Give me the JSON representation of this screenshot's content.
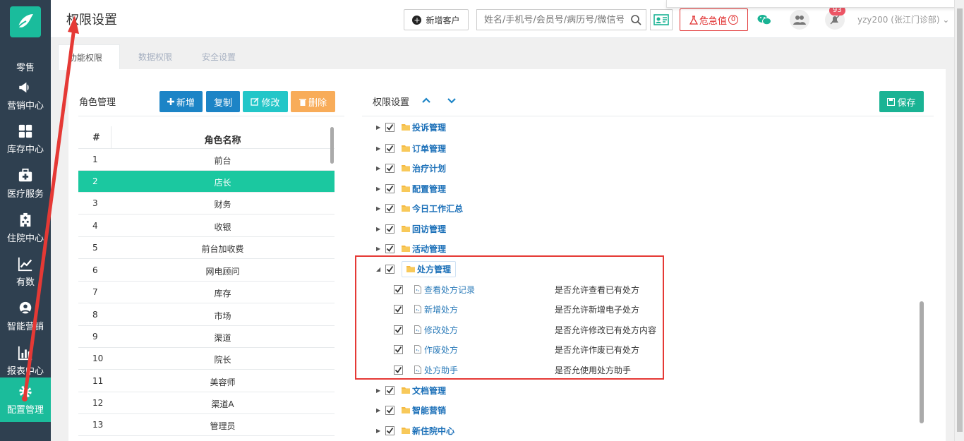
{
  "sidebar": {
    "items": [
      {
        "label": "零售",
        "icon": "retail-icon"
      },
      {
        "label": "营销中心",
        "icon": "megaphone-icon"
      },
      {
        "label": "库存中心",
        "icon": "grid-icon"
      },
      {
        "label": "医疗服务",
        "icon": "medkit-icon"
      },
      {
        "label": "住院中心",
        "icon": "hospital-icon"
      },
      {
        "label": "有数",
        "icon": "line-chart-icon"
      },
      {
        "label": "智能营销",
        "icon": "brain-icon"
      },
      {
        "label": "报表中心",
        "icon": "bar-chart-icon"
      },
      {
        "label": "配置管理",
        "icon": "gear-icon"
      }
    ],
    "active_index": 8
  },
  "header": {
    "title": "权限设置",
    "new_customer": "新增客户",
    "search_placeholder": "姓名/手机号/会员号/病历号/微信号",
    "danger_label": "危急值",
    "danger_count": "0",
    "notification_badge": "93",
    "user": "yzy200 (张江门诊部)"
  },
  "tabs": [
    "功能权限",
    "数据权限",
    "安全设置"
  ],
  "left_panel": {
    "title": "角色管理",
    "buttons": {
      "add": "新增",
      "copy": "复制",
      "edit": "修改",
      "delete": "删除"
    },
    "table": {
      "headers": [
        "#",
        "角色名称"
      ],
      "rows": [
        {
          "idx": "1",
          "name": "前台"
        },
        {
          "idx": "2",
          "name": "店长"
        },
        {
          "idx": "3",
          "name": "财务"
        },
        {
          "idx": "4",
          "name": "收银"
        },
        {
          "idx": "5",
          "name": "前台加收费"
        },
        {
          "idx": "6",
          "name": "网电顾问"
        },
        {
          "idx": "7",
          "name": "库存"
        },
        {
          "idx": "8",
          "name": "市场"
        },
        {
          "idx": "9",
          "name": "渠道"
        },
        {
          "idx": "10",
          "name": "院长"
        },
        {
          "idx": "11",
          "name": "美容师"
        },
        {
          "idx": "12",
          "name": "渠道A"
        },
        {
          "idx": "13",
          "name": "管理员"
        }
      ],
      "selected_index": 1
    }
  },
  "right_panel": {
    "title": "权限设置",
    "save": "保存",
    "tree": [
      {
        "label": "投诉管理",
        "checked": true,
        "expanded": false
      },
      {
        "label": "订单管理",
        "checked": true,
        "expanded": false
      },
      {
        "label": "治疗计划",
        "checked": true,
        "expanded": false
      },
      {
        "label": "配置管理",
        "checked": true,
        "expanded": false
      },
      {
        "label": "今日工作汇总",
        "checked": true,
        "expanded": false
      },
      {
        "label": "回访管理",
        "checked": true,
        "expanded": false
      },
      {
        "label": "活动管理",
        "checked": true,
        "expanded": false
      },
      {
        "label": "处方管理",
        "checked": true,
        "expanded": true,
        "children": [
          {
            "label": "查看处方记录",
            "desc": "是否允许查看已有处方",
            "checked": true
          },
          {
            "label": "新增处方",
            "desc": "是否允许新增电子处方",
            "checked": true
          },
          {
            "label": "修改处方",
            "desc": "是否允许修改已有处方内容",
            "checked": true
          },
          {
            "label": "作废处方",
            "desc": "是否允许作废已有处方",
            "checked": true
          },
          {
            "label": "处方助手",
            "desc": "是否允使用处方助手",
            "checked": true
          }
        ]
      },
      {
        "label": "文档管理",
        "checked": true,
        "expanded": false
      },
      {
        "label": "智能营销",
        "checked": true,
        "expanded": false
      },
      {
        "label": "新住院中心",
        "checked": true,
        "expanded": false
      }
    ]
  },
  "colors": {
    "sidebar": "#2f4050",
    "accent": "#1ab394",
    "selected_row": "#1bc8a0",
    "primary": "#1c84c6",
    "warning": "#f8ac59",
    "danger": "#e03030"
  }
}
